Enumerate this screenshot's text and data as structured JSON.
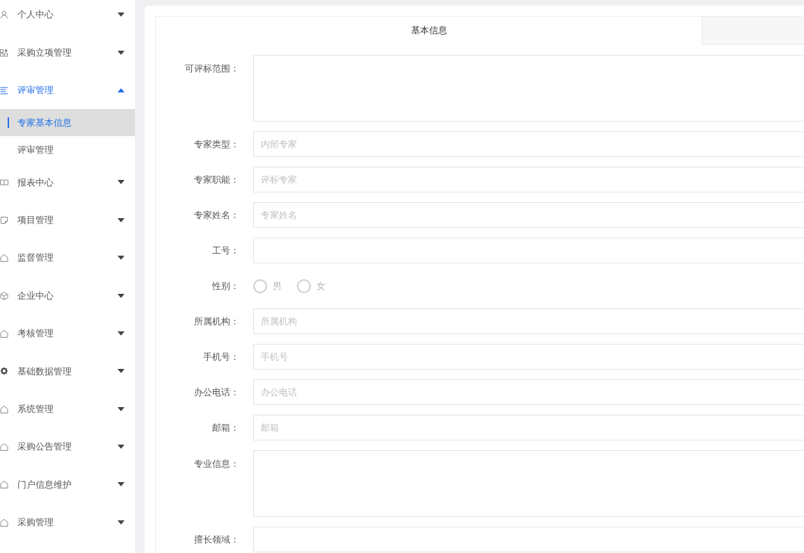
{
  "sidebar": {
    "items": [
      {
        "label": "个人中心",
        "expanded": false
      },
      {
        "label": "采购立项管理",
        "expanded": false
      },
      {
        "label": "评审管理",
        "expanded": true,
        "children": [
          {
            "label": "专家基本信息",
            "selected": true
          },
          {
            "label": "评审管理",
            "selected": false
          }
        ]
      },
      {
        "label": "报表中心",
        "expanded": false
      },
      {
        "label": "项目管理",
        "expanded": false
      },
      {
        "label": "监督管理",
        "expanded": false
      },
      {
        "label": "企业中心",
        "expanded": false
      },
      {
        "label": "考核管理",
        "expanded": false
      },
      {
        "label": "基础数据管理",
        "expanded": false
      },
      {
        "label": "系统管理",
        "expanded": false
      },
      {
        "label": "采购公告管理",
        "expanded": false
      },
      {
        "label": "门户信息维护",
        "expanded": false
      },
      {
        "label": "采购管理",
        "expanded": false
      }
    ]
  },
  "tabs": [
    {
      "label": "基本信息",
      "selected": true
    },
    {
      "selected": false
    }
  ],
  "form": {
    "fields": [
      {
        "kind": "textarea",
        "label": "可评标范围："
      },
      {
        "kind": "input",
        "label": "专家类型：",
        "placeholder": "内部专家"
      },
      {
        "kind": "input",
        "label": "专家职能：",
        "placeholder": "评标专家"
      },
      {
        "kind": "input",
        "label": "专家姓名：",
        "placeholder": "专家姓名"
      },
      {
        "kind": "input",
        "label": "工号："
      },
      {
        "kind": "radio",
        "label": "性别：",
        "options": [
          {
            "label": "男",
            "selected": false
          },
          {
            "label": "女",
            "selected": false
          }
        ]
      },
      {
        "kind": "input",
        "label": "所属机构：",
        "placeholder": "所属机构"
      },
      {
        "kind": "input",
        "label": "手机号：",
        "placeholder": "手机号"
      },
      {
        "kind": "input",
        "label": "办公电话：",
        "placeholder": "办公电话"
      },
      {
        "kind": "input",
        "label": "邮箱：",
        "placeholder": "邮箱"
      },
      {
        "kind": "textarea",
        "label": "专业信息："
      },
      {
        "kind": "input",
        "label": "擅长领域："
      }
    ]
  }
}
